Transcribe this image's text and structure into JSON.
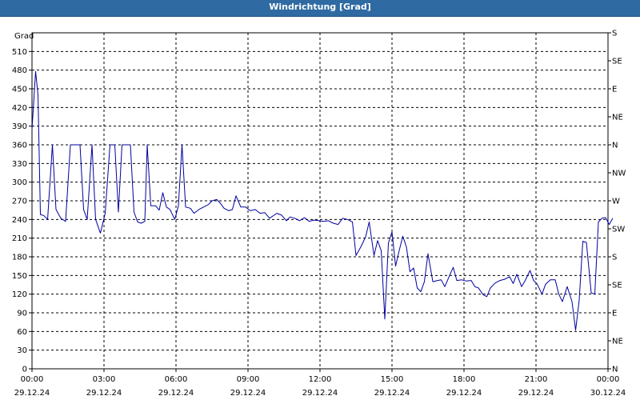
{
  "window": {
    "title": "Windrichtung [Grad]"
  },
  "chart_data": {
    "type": "line",
    "title": "Windrichtung [Grad]",
    "ylabel": "Grad",
    "ylim": [
      0,
      540
    ],
    "yticks": [
      0,
      30,
      60,
      90,
      120,
      150,
      180,
      210,
      240,
      270,
      300,
      330,
      360,
      390,
      420,
      450,
      480,
      510
    ],
    "y2_ticks": [
      {
        "v": 0,
        "label": "N"
      },
      {
        "v": 45,
        "label": "NE"
      },
      {
        "v": 90,
        "label": "E"
      },
      {
        "v": 135,
        "label": "SE"
      },
      {
        "v": 180,
        "label": "S"
      },
      {
        "v": 225,
        "label": "SW"
      },
      {
        "v": 270,
        "label": "W"
      },
      {
        "v": 315,
        "label": "NW"
      },
      {
        "v": 360,
        "label": "N"
      },
      {
        "v": 405,
        "label": "NE"
      },
      {
        "v": 450,
        "label": "E"
      },
      {
        "v": 495,
        "label": "SE"
      },
      {
        "v": 540,
        "label": "S"
      }
    ],
    "xlim": [
      0,
      24
    ],
    "xticks": [
      {
        "h": 0,
        "time": "00:00",
        "date": "29.12.24"
      },
      {
        "h": 3,
        "time": "03:00",
        "date": "29.12.24"
      },
      {
        "h": 6,
        "time": "06:00",
        "date": "29.12.24"
      },
      {
        "h": 9,
        "time": "09:00",
        "date": "29.12.24"
      },
      {
        "h": 12,
        "time": "12:00",
        "date": "29.12.24"
      },
      {
        "h": 15,
        "time": "15:00",
        "date": "29.12.24"
      },
      {
        "h": 18,
        "time": "18:00",
        "date": "29.12.24"
      },
      {
        "h": 21,
        "time": "21:00",
        "date": "29.12.24"
      },
      {
        "h": 24,
        "time": "00:00",
        "date": "30.12.24"
      }
    ],
    "grid": true,
    "series": [
      {
        "color": "#0000a0",
        "points": [
          [
            0.0,
            385
          ],
          [
            0.15,
            478
          ],
          [
            0.25,
            440
          ],
          [
            0.35,
            248
          ],
          [
            0.5,
            246
          ],
          [
            0.65,
            240
          ],
          [
            0.85,
            360
          ],
          [
            1.0,
            256
          ],
          [
            1.2,
            242
          ],
          [
            1.4,
            237
          ],
          [
            1.6,
            360
          ],
          [
            1.8,
            360
          ],
          [
            2.0,
            360
          ],
          [
            2.15,
            256
          ],
          [
            2.3,
            240
          ],
          [
            2.5,
            360
          ],
          [
            2.65,
            240
          ],
          [
            2.85,
            218
          ],
          [
            3.05,
            250
          ],
          [
            3.25,
            360
          ],
          [
            3.45,
            360
          ],
          [
            3.6,
            252
          ],
          [
            3.75,
            360
          ],
          [
            3.9,
            360
          ],
          [
            4.1,
            360
          ],
          [
            4.25,
            252
          ],
          [
            4.4,
            236
          ],
          [
            4.55,
            234
          ],
          [
            4.7,
            237
          ],
          [
            4.8,
            360
          ],
          [
            4.95,
            262
          ],
          [
            5.15,
            262
          ],
          [
            5.3,
            255
          ],
          [
            5.45,
            283
          ],
          [
            5.6,
            260
          ],
          [
            5.75,
            256
          ],
          [
            5.95,
            240
          ],
          [
            6.1,
            262
          ],
          [
            6.25,
            360
          ],
          [
            6.4,
            260
          ],
          [
            6.6,
            258
          ],
          [
            6.75,
            250
          ],
          [
            6.95,
            256
          ],
          [
            7.15,
            260
          ],
          [
            7.35,
            264
          ],
          [
            7.5,
            270
          ],
          [
            7.7,
            272
          ],
          [
            7.85,
            266
          ],
          [
            8.0,
            258
          ],
          [
            8.2,
            254
          ],
          [
            8.35,
            256
          ],
          [
            8.5,
            278
          ],
          [
            8.7,
            260
          ],
          [
            8.9,
            260
          ],
          [
            9.1,
            254
          ],
          [
            9.3,
            256
          ],
          [
            9.5,
            250
          ],
          [
            9.7,
            251
          ],
          [
            9.9,
            242
          ],
          [
            10.2,
            250
          ],
          [
            10.4,
            247
          ],
          [
            10.6,
            238
          ],
          [
            10.75,
            244
          ],
          [
            10.95,
            242
          ],
          [
            11.15,
            238
          ],
          [
            11.35,
            243
          ],
          [
            11.55,
            237
          ],
          [
            11.75,
            239
          ],
          [
            11.95,
            238
          ],
          [
            12.15,
            237
          ],
          [
            12.35,
            238
          ],
          [
            12.55,
            234
          ],
          [
            12.75,
            232
          ],
          [
            12.95,
            242
          ],
          [
            13.15,
            240
          ],
          [
            13.35,
            236
          ],
          [
            13.5,
            182
          ],
          [
            13.7,
            196
          ],
          [
            13.9,
            212
          ],
          [
            14.05,
            236
          ],
          [
            14.25,
            182
          ],
          [
            14.4,
            206
          ],
          [
            14.55,
            190
          ],
          [
            14.7,
            80
          ],
          [
            14.85,
            202
          ],
          [
            15.0,
            220
          ],
          [
            15.15,
            165
          ],
          [
            15.3,
            190
          ],
          [
            15.45,
            213
          ],
          [
            15.6,
            196
          ],
          [
            15.75,
            156
          ],
          [
            15.9,
            162
          ],
          [
            16.05,
            130
          ],
          [
            16.2,
            124
          ],
          [
            16.35,
            140
          ],
          [
            16.5,
            185
          ],
          [
            16.7,
            140
          ],
          [
            16.9,
            142
          ],
          [
            17.05,
            143
          ],
          [
            17.2,
            132
          ],
          [
            17.4,
            150
          ],
          [
            17.55,
            163
          ],
          [
            17.7,
            142
          ],
          [
            17.9,
            143
          ],
          [
            18.1,
            141
          ],
          [
            18.3,
            142
          ],
          [
            18.45,
            132
          ],
          [
            18.6,
            130
          ],
          [
            18.8,
            119
          ],
          [
            18.95,
            116
          ],
          [
            19.1,
            130
          ],
          [
            19.3,
            138
          ],
          [
            19.5,
            142
          ],
          [
            19.7,
            144
          ],
          [
            19.9,
            148
          ],
          [
            20.05,
            137
          ],
          [
            20.2,
            152
          ],
          [
            20.4,
            132
          ],
          [
            20.55,
            142
          ],
          [
            20.75,
            158
          ],
          [
            20.9,
            142
          ],
          [
            21.05,
            136
          ],
          [
            21.25,
            120
          ],
          [
            21.4,
            136
          ],
          [
            21.6,
            143
          ],
          [
            21.8,
            143
          ],
          [
            21.95,
            120
          ],
          [
            22.1,
            108
          ],
          [
            22.3,
            132
          ],
          [
            22.5,
            108
          ],
          [
            22.65,
            62
          ],
          [
            22.8,
            110
          ],
          [
            22.95,
            205
          ],
          [
            23.1,
            203
          ],
          [
            23.3,
            122
          ],
          [
            23.45,
            120
          ],
          [
            23.6,
            236
          ],
          [
            23.75,
            242
          ],
          [
            23.9,
            243
          ],
          [
            24.05,
            232
          ],
          [
            24.2,
            242
          ]
        ]
      }
    ]
  }
}
